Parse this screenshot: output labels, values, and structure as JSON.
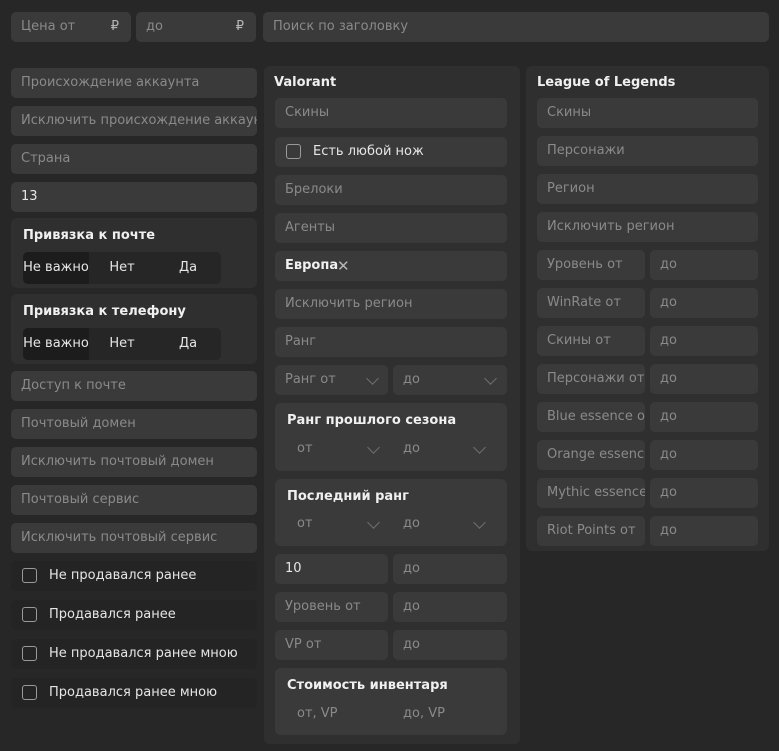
{
  "top": {
    "price_from": "Цена от",
    "price_to": "до",
    "currency": "₽",
    "search_placeholder": "Поиск по заголовку"
  },
  "left": {
    "origin": "Происхождение аккаунта",
    "exclude_origin": "Исключить происхождение аккаунта",
    "country": "Страна",
    "country_value": "13",
    "email_binding": {
      "title": "Привязка к почте",
      "options": [
        "Не важно",
        "Нет",
        "Да"
      ]
    },
    "phone_binding": {
      "title": "Привязка к телефону",
      "options": [
        "Не важно",
        "Нет",
        "Да"
      ]
    },
    "email_access": "Доступ к почте",
    "email_domain": "Почтовый домен",
    "exclude_email_domain": "Исключить почтовый домен",
    "email_service": "Почтовый сервис",
    "exclude_email_service": "Исключить почтовый сервис",
    "checkboxes": [
      "Не продавался ранее",
      "Продавался ранее",
      "Не продавался ранее мною",
      "Продавался ранее мною"
    ]
  },
  "valorant": {
    "title": "Valorant",
    "skins": "Скины",
    "any_knife": "Есть любой нож",
    "charms": "Брелоки",
    "agents": "Агенты",
    "region_tag": "Европа",
    "exclude_region": "Исключить регион",
    "rank": "Ранг",
    "rank_from": "Ранг от",
    "rank_to": "до",
    "prev_season": {
      "title": "Ранг прошлого сезона",
      "from": "от",
      "to": "до"
    },
    "last_rank": {
      "title": "Последний ранг",
      "from": "от",
      "to": "до"
    },
    "level_min_value": "10",
    "level_max_placeholder": "до",
    "level_from": "Уровень от",
    "level_to": "до",
    "vp_from": "VP от",
    "vp_to": "до",
    "inventory": {
      "title": "Стоимость инвентаря",
      "from": "от, VP",
      "to": "до, VP"
    }
  },
  "lol": {
    "title": "League of Legends",
    "skins": "Скины",
    "champions": "Персонажи",
    "region": "Регион",
    "exclude_region": "Исключить регион",
    "ranges": [
      {
        "from": "Уровень от",
        "to": "до"
      },
      {
        "from": "WinRate от",
        "to": "до"
      },
      {
        "from": "Скины от",
        "to": "до"
      },
      {
        "from": "Персонажи от",
        "to": "до"
      },
      {
        "from": "Blue essence от",
        "to": "до"
      },
      {
        "from": "Orange essence от",
        "to": "до"
      },
      {
        "from": "Mythic essence от",
        "to": "до"
      },
      {
        "from": "Riot Points от",
        "to": "до"
      }
    ]
  },
  "colors": {
    "bg": "#272727",
    "panel": "#2f2f2f",
    "input": "#3a3a3a"
  }
}
